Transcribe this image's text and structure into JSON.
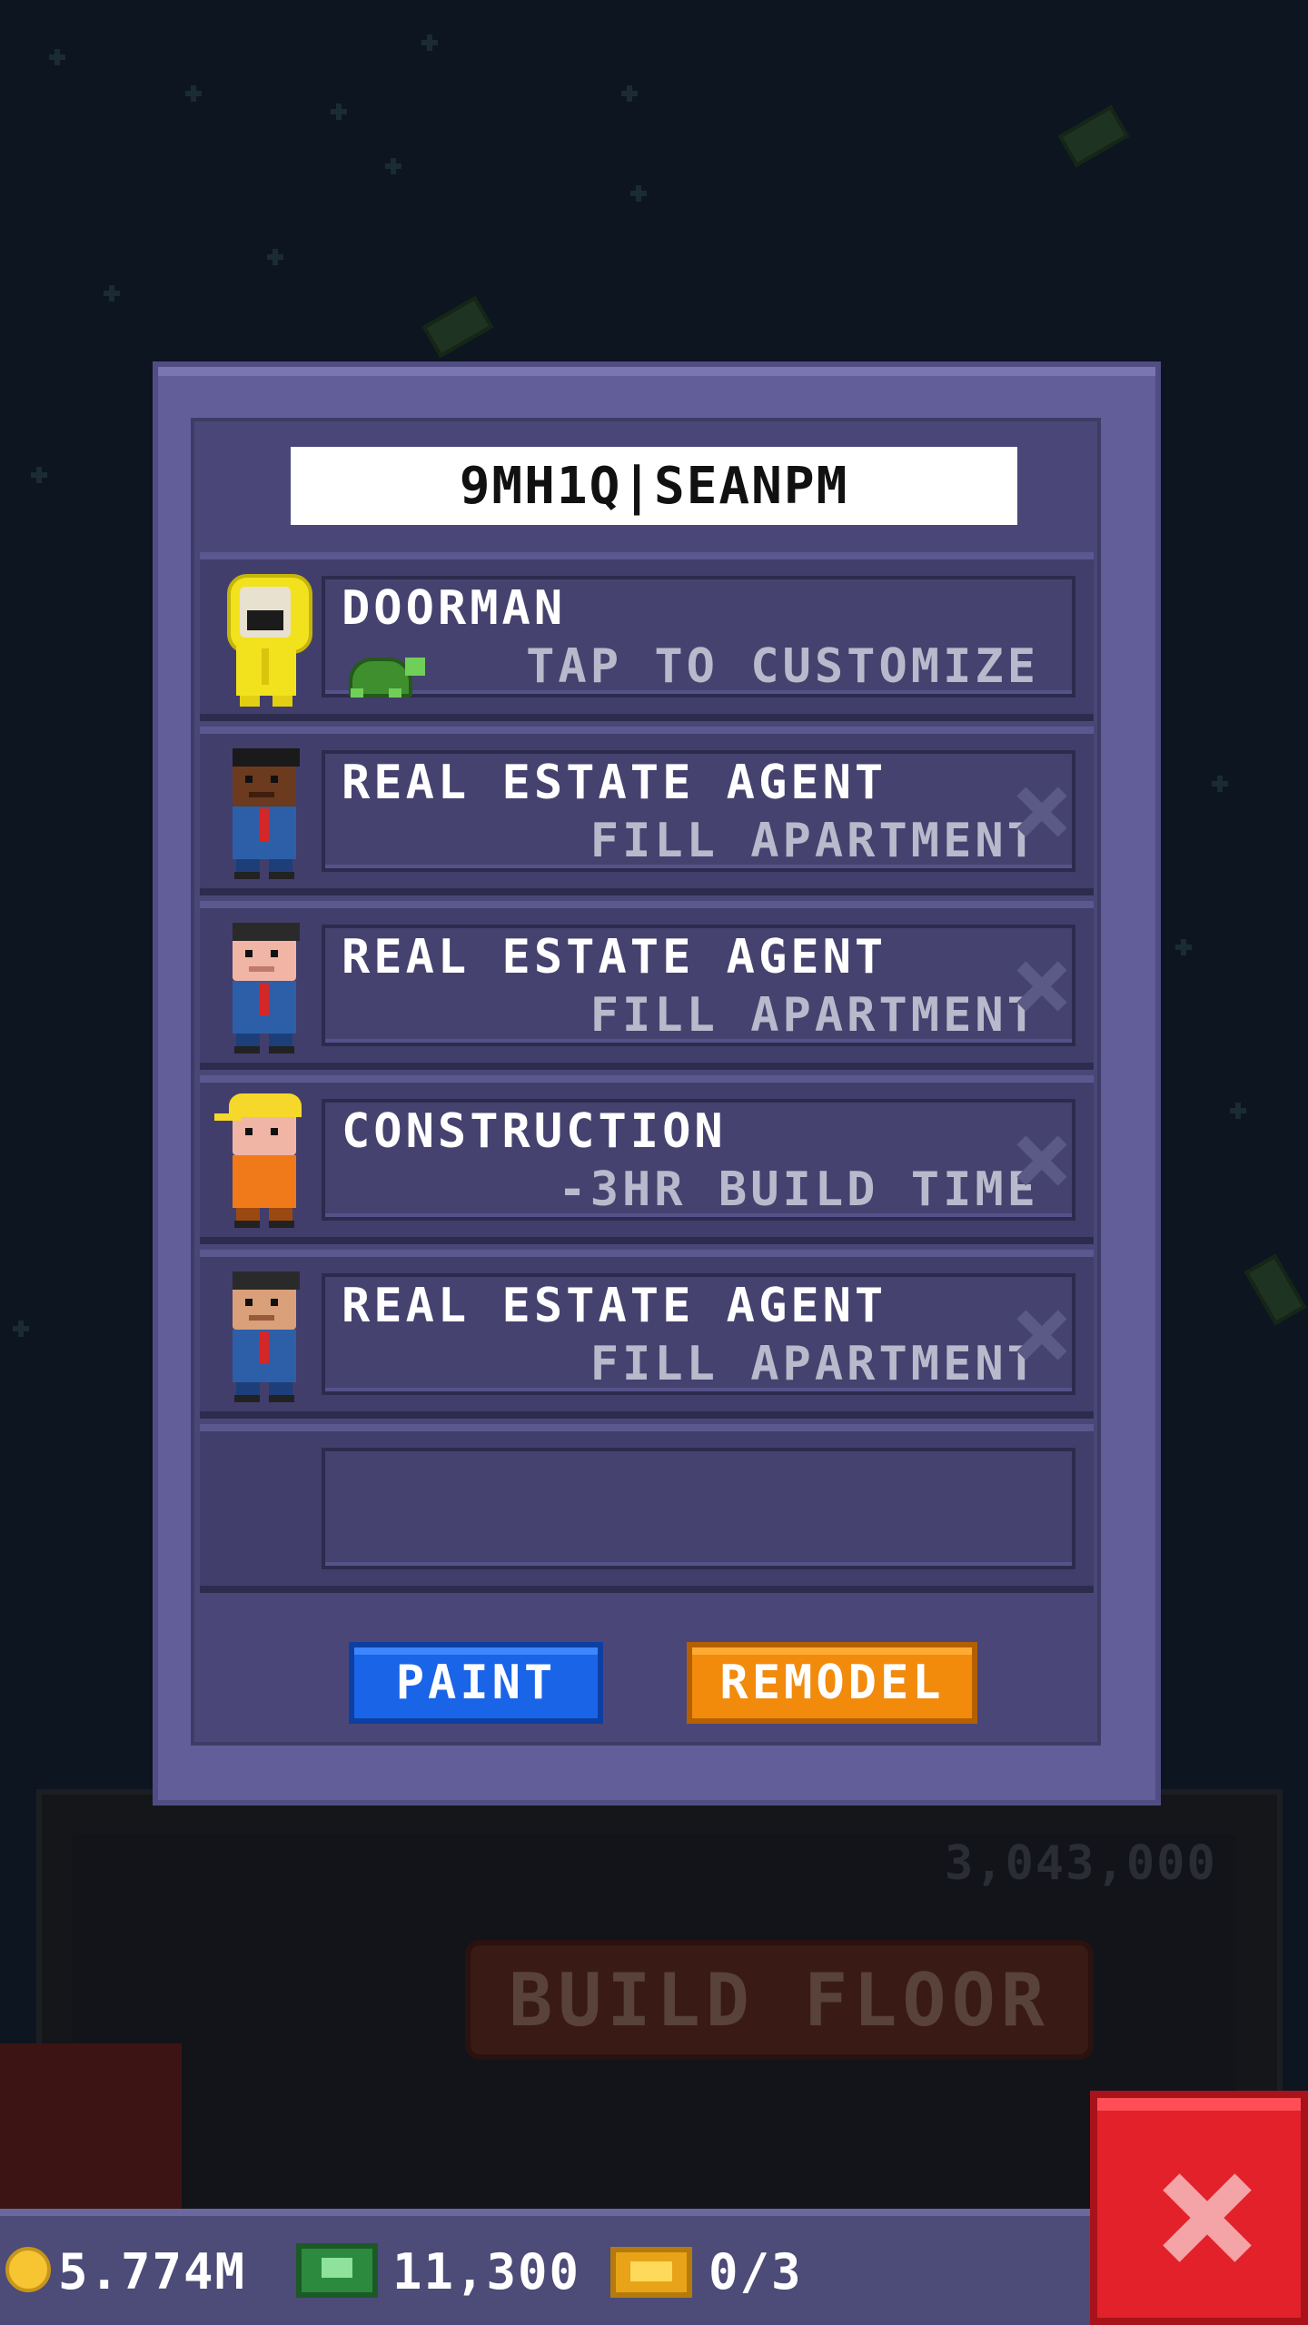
{
  "name_field": {
    "value": "9MH1Q|SEANPM"
  },
  "rows": [
    {
      "title": "DOORMAN",
      "subtitle": "TAP TO CUSTOMIZE",
      "avatar": "doorman-raincoat",
      "pet_icon": "turtle-icon"
    },
    {
      "title": "REAL ESTATE AGENT",
      "subtitle": "FILL APARTMENT",
      "avatar": "agent-dark"
    },
    {
      "title": "REAL ESTATE AGENT",
      "subtitle": "FILL APARTMENT",
      "avatar": "agent-light"
    },
    {
      "title": "CONSTRUCTION",
      "subtitle": "-3HR BUILD TIME",
      "avatar": "construction-worker"
    },
    {
      "title": "REAL ESTATE AGENT",
      "subtitle": "FILL APARTMENT",
      "avatar": "agent-tan"
    },
    {
      "title": "",
      "subtitle": ""
    }
  ],
  "buttons": {
    "paint": "PAINT",
    "remodel": "REMODEL"
  },
  "background": {
    "build_floor": "BUILD FLOOR",
    "price": "3,043,000"
  },
  "status": {
    "coins": "5.774M",
    "bux": "11,300",
    "tickets": "0/3"
  },
  "colors": {
    "paint": "#1a64e8",
    "remodel": "#f28a0c",
    "close": "#e3212b"
  }
}
